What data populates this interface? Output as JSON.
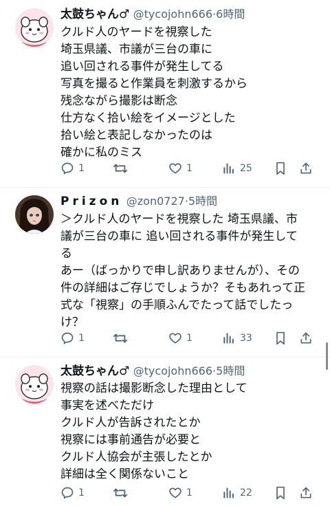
{
  "tweets": [
    {
      "name": "太鼓ちゃん♂",
      "handle": "@tycojohn666",
      "time": "6時間",
      "lines": [
        "クルド人のヤードを視察した",
        "埼玉県議、市議が三台の車に",
        "追い回される事件が発生してる",
        "写真を撮ると作業員を刺激するから",
        "残念ながら撮影は断念",
        "仕方なく拾い絵をイメージとした",
        "拾い絵と表記しなかったのは",
        "確かに私のミス"
      ],
      "replies": "1",
      "retweets": "",
      "likes": "1",
      "views": "25"
    },
    {
      "name": "Prizon",
      "handle": "@zon0727",
      "time": "5時間",
      "paragraphs": [
        "＞クルド人のヤードを視察した 埼玉県議、市議が三台の車に 追い回される事件が発生してる",
        "あー（ばっかりで申し訳ありませんが）、その件の詳細はご存じでしょうか？そもあれって正式な「視察」の手順ふんでたって話でしたっけ？"
      ],
      "replies": "1",
      "retweets": "",
      "likes": "1",
      "views": "33"
    },
    {
      "name": "太鼓ちゃん♂",
      "handle": "@tycojohn666",
      "time": "5時間",
      "lines": [
        "視察の話は撮影断念した理由として",
        "事実を述べただけ",
        "クルド人が告訴されたとか",
        "視察には事前通告が必要と",
        "クルド人協会が主張したとか",
        "詳細は全く関係ないこと"
      ],
      "replies": "1",
      "retweets": "",
      "likes": "1",
      "views": "22"
    }
  ],
  "separator": "·",
  "icons": {
    "reply": "reply-icon",
    "retweet": "retweet-icon",
    "like": "heart-icon",
    "views": "views-icon",
    "bookmark": "bookmark-icon",
    "share": "share-icon"
  },
  "colors": {
    "text": "#0f1419",
    "muted": "#536471",
    "divider": "#eff3f4"
  }
}
